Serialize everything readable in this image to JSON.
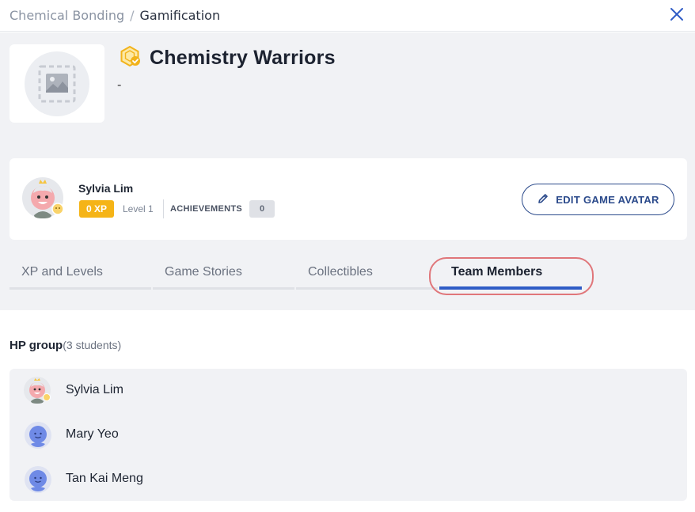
{
  "breadcrumb": {
    "parent": "Chemical Bonding",
    "separator": "/",
    "current": "Gamification"
  },
  "game": {
    "title": "Chemistry Warriors",
    "description": "-"
  },
  "profile": {
    "name": "Sylvia Lim",
    "xp": "0 XP",
    "level": "Level 1",
    "achievements_label": "ACHIEVEMENTS",
    "achievements_count": "0",
    "edit_button": "EDIT GAME AVATAR"
  },
  "tabs": [
    {
      "label": "XP and Levels",
      "active": false
    },
    {
      "label": "Game Stories",
      "active": false
    },
    {
      "label": "Collectibles",
      "active": false
    },
    {
      "label": "Team Members",
      "active": true
    }
  ],
  "group": {
    "name": "HP group",
    "count": "(3 students)",
    "members": [
      {
        "name": "Sylvia Lim",
        "avatar": "custom-avatar"
      },
      {
        "name": "Mary Yeo",
        "avatar": "default-avatar"
      },
      {
        "name": "Tan Kai Meng",
        "avatar": "default-avatar"
      }
    ]
  },
  "colors": {
    "accent": "#2f5cc6",
    "button_border": "#2b4a8b",
    "xp_badge": "#f5b417",
    "highlight": "#e0767a",
    "panel_bg": "#f1f2f5"
  },
  "icons": {
    "close": "close-icon",
    "image_placeholder": "image-placeholder-icon",
    "game_badge": "game-badge-icon",
    "edit": "pencil-icon"
  }
}
